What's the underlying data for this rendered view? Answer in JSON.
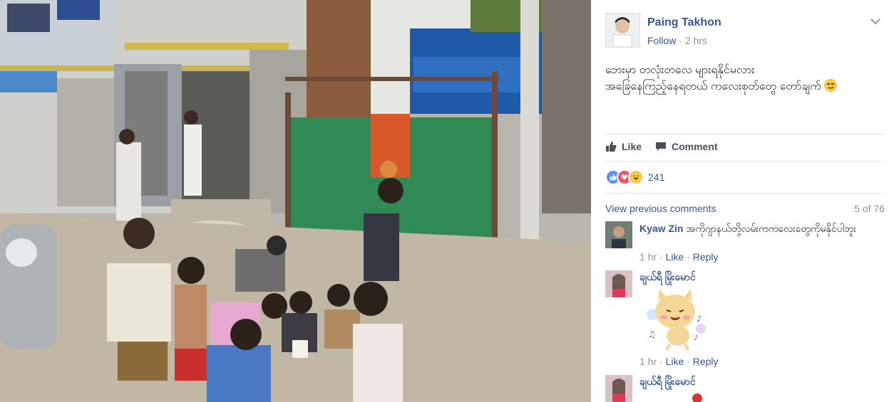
{
  "post": {
    "author": "Paing Takhon",
    "follow": "Follow",
    "dot": "·",
    "time": "2 hrs",
    "text_line1": "ဘေးမှာ တလုံးတလေ များရနိုင်မလား",
    "text_line2": "အခြေနေကြည့်နေရတယ် ကလေးစုတ်တွေ တော်ချက်"
  },
  "actions": {
    "like": "Like",
    "comment": "Comment"
  },
  "reactions": {
    "count": "241",
    "types": [
      "like-icon",
      "love-icon",
      "haha-icon"
    ]
  },
  "comments_nav": {
    "view_previous": "View previous comments",
    "pager": "5 of 76"
  },
  "comments": [
    {
      "name": "Kyaw Zin",
      "text": "အကိုဂျာနယ်တို့လမ်းကကလေးတွေကိုမနိုင်ပါဘူး",
      "time": "1 hr",
      "like": "Like",
      "reply": "Reply"
    },
    {
      "name": "ချယ်ရီ မြိုးမောင်",
      "text": "",
      "time": "1 hr",
      "like": "Like",
      "reply": "Reply",
      "sticker": "cat-sticker"
    },
    {
      "name": "ချယ်ရီ မြိုးမောင်"
    }
  ],
  "colors": {
    "link": "#365899",
    "muted": "#90949c",
    "text": "#1d2129",
    "like_blue": "#5890ff",
    "love_red": "#f25268",
    "haha_yellow": "#f7c948"
  }
}
